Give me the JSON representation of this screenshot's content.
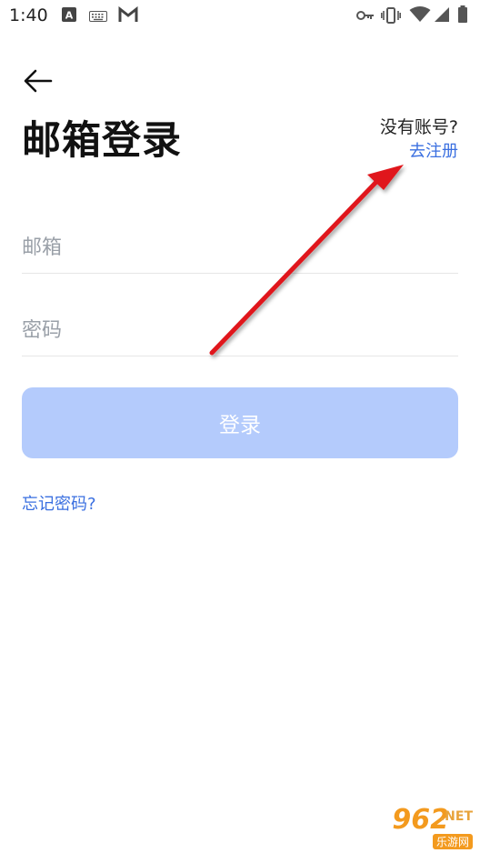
{
  "status_bar": {
    "time": "1:40",
    "left_icons": [
      "font-download-icon",
      "keyboard-icon",
      "gmail-icon"
    ],
    "right_icons": [
      "vpn-key-icon",
      "vibrate-icon",
      "wifi-icon",
      "signal-icon",
      "battery-icon"
    ]
  },
  "header": {
    "back_icon": "arrow-left-icon",
    "title": "邮箱登录",
    "no_account_text": "没有账号?",
    "register_link": "去注册"
  },
  "form": {
    "email_placeholder": "邮箱",
    "email_value": "",
    "password_placeholder": "密码",
    "password_value": "",
    "login_button": "登录",
    "forgot_password": "忘记密码?"
  },
  "colors": {
    "link": "#3a6fe0",
    "button_disabled": "#b4cbfc",
    "annotation_arrow": "#e0161b"
  },
  "watermark": {
    "brand": "962",
    "suffix": ".NET",
    "subtitle": "乐游网"
  }
}
